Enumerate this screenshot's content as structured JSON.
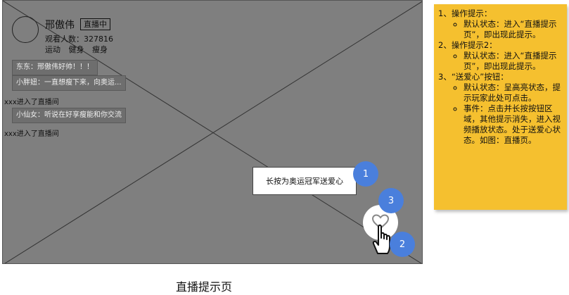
{
  "host": {
    "name": "邢傲伟",
    "live_badge": "直播中",
    "viewers": "观看人数：327816",
    "tags": [
      "运动",
      "健身",
      "瘦身"
    ]
  },
  "chat": [
    {
      "kind": "bubble",
      "text": "东东：邢傲伟好帅！！！"
    },
    {
      "kind": "bubble",
      "text": "小胖妞：一直想瘦下来，向奥运..."
    },
    {
      "kind": "plain",
      "text": "xxx进入了直播间"
    },
    {
      "kind": "bubble",
      "text": "小仙女：听说在好享瘦能和你交流"
    },
    {
      "kind": "plain",
      "text": "xxx进入了直播间"
    }
  ],
  "tip": {
    "text": "长按为奥运冠军送爱心"
  },
  "badges": [
    "1",
    "2",
    "3"
  ],
  "caption": "直播提示页",
  "notes": [
    {
      "title": "1、操作提示：",
      "items": [
        "默认状态：进入“直播提示页”，即出现此提示。"
      ]
    },
    {
      "title": "2、操作提示2：",
      "items": [
        "默认状态：进入“直播提示页”，即出现此提示。"
      ]
    },
    {
      "title": "3、“送爱心”按钮：",
      "items": [
        "默认状态：呈高亮状态，提示玩家此处可点击。",
        "事件：点击并长按按钮区域，其他提示消失，进入视频播放状态。处于送爱心状态。如图：直播页。"
      ]
    }
  ],
  "colors": {
    "frame": "#7f7f7f",
    "note": "#f5c02f",
    "badge": "#4a7fdc"
  }
}
